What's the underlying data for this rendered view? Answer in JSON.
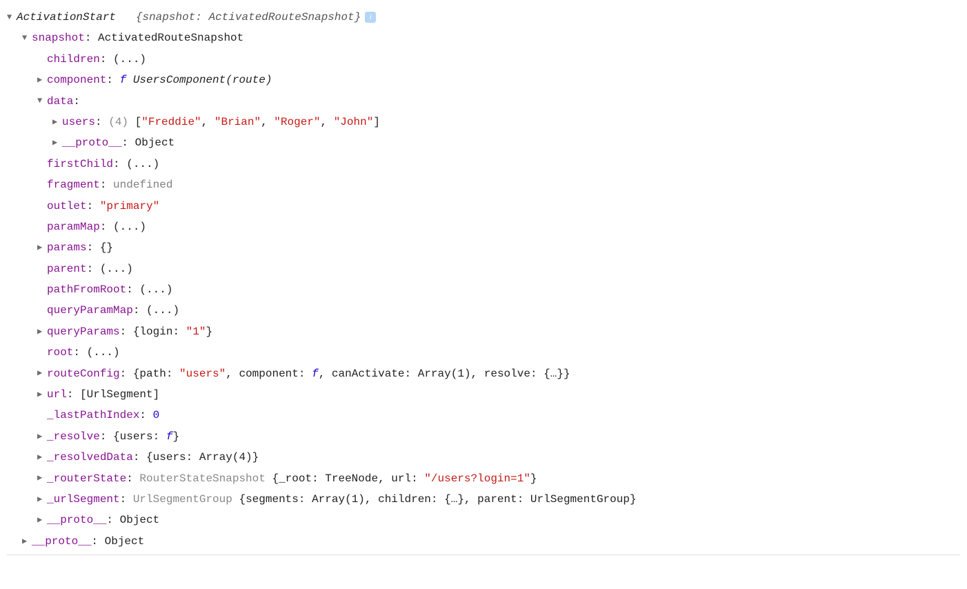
{
  "root": {
    "className": "ActivationStart",
    "summary": "{snapshot: ActivatedRouteSnapshot}",
    "infoGlyph": "i"
  },
  "snapshot": {
    "key": "snapshot",
    "type": "ActivatedRouteSnapshot",
    "children": {
      "key": "children",
      "val": "(...)"
    },
    "component": {
      "key": "component",
      "fnName": "UsersComponent(route)"
    },
    "data": {
      "key": "data",
      "users": {
        "key": "users",
        "count": "(4)",
        "items": [
          "\"Freddie\"",
          "\"Brian\"",
          "\"Roger\"",
          "\"John\""
        ]
      },
      "proto": {
        "key": "__proto__",
        "val": "Object"
      }
    },
    "firstChild": {
      "key": "firstChild",
      "val": "(...)"
    },
    "fragment": {
      "key": "fragment",
      "val": "undefined"
    },
    "outlet": {
      "key": "outlet",
      "val": "\"primary\""
    },
    "paramMap": {
      "key": "paramMap",
      "val": "(...)"
    },
    "params": {
      "key": "params",
      "val": "{}"
    },
    "parent": {
      "key": "parent",
      "val": "(...)"
    },
    "pathFromRoot": {
      "key": "pathFromRoot",
      "val": "(...)"
    },
    "queryParamMap": {
      "key": "queryParamMap",
      "val": "(...)"
    },
    "queryParams": {
      "key": "queryParams",
      "prefix": "{login: ",
      "val": "\"1\"",
      "suffix": "}"
    },
    "rootProp": {
      "key": "root",
      "val": "(...)"
    },
    "routeConfig": {
      "key": "routeConfig",
      "p1a": "{path: ",
      "p1v": "\"users\"",
      "p2": ", component: ",
      "p3": ", canActivate: Array(1), resolve: {…}}"
    },
    "url": {
      "key": "url",
      "val": "[UrlSegment]"
    },
    "lastPathIndex": {
      "key": "_lastPathIndex",
      "val": "0"
    },
    "resolve": {
      "key": "_resolve",
      "prefix": "{users: ",
      "suffix": "}"
    },
    "resolvedData": {
      "key": "_resolvedData",
      "val": "{users: Array(4)}"
    },
    "routerState": {
      "key": "_routerState",
      "type": "RouterStateSnapshot",
      "p1": " {_root: TreeNode, url: ",
      "urlVal": "\"/users?login=1\"",
      "p2": "}"
    },
    "urlSegment": {
      "key": "_urlSegment",
      "type": "UrlSegmentGroup",
      "rest": " {segments: Array(1), children: {…}, parent: UrlSegmentGroup}"
    },
    "proto": {
      "key": "__proto__",
      "val": "Object"
    }
  },
  "outerProto": {
    "key": "__proto__",
    "val": "Object"
  }
}
